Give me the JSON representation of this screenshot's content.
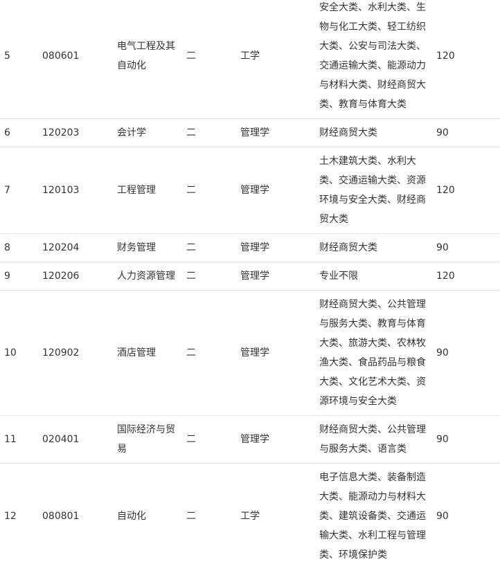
{
  "table": {
    "rows": [
      {
        "no": "5",
        "code": "080601",
        "major": "电气工程及其自动化",
        "degree_type": "二",
        "category": "工学",
        "groups": "安全大类、水利大类、生物与化工大类、轻工纺织大类、公安与司法大类、交通运输大类、能源动力与材料大类、财经商贸大类、教育与体育大类",
        "quota": "120"
      },
      {
        "no": "6",
        "code": "120203",
        "major": "会计学",
        "degree_type": "二",
        "category": "管理学",
        "groups": "财经商贸大类",
        "quota": "90"
      },
      {
        "no": "7",
        "code": "120103",
        "major": "工程管理",
        "degree_type": "二",
        "category": "管理学",
        "groups": "土木建筑大类、水利大类、交通运输大类、资源环境与安全大类、财经商贸大类",
        "quota": "120"
      },
      {
        "no": "8",
        "code": "120204",
        "major": "财务管理",
        "degree_type": "二",
        "category": "管理学",
        "groups": "财经商贸大类",
        "quota": "90"
      },
      {
        "no": "9",
        "code": "120206",
        "major": "人力资源管理",
        "degree_type": "二",
        "category": "管理学",
        "groups": "专业不限",
        "quota": "120"
      },
      {
        "no": "10",
        "code": "120902",
        "major": "酒店管理",
        "degree_type": "二",
        "category": "管理学",
        "groups": "财经商贸大类、公共管理与服务大类、教育与体育大类、旅游大类、农林牧渔大类、食品药品与粮食大类、文化艺术大类、资源环境与安全大类",
        "quota": "90"
      },
      {
        "no": "11",
        "code": "020401",
        "major": "国际经济与贸易",
        "degree_type": "二",
        "category": "管理学",
        "groups": "财经商贸大类、公共管理与服务大类、语言类",
        "quota": "90"
      },
      {
        "no": "12",
        "code": "080801",
        "major": "自动化",
        "degree_type": "二",
        "category": "工学",
        "groups": "电子信息大类、装备制造大类、能源动力与材料大类、建筑设备类、交通运输大类、水利工程与管理类、环境保护类",
        "quota": "90"
      }
    ]
  }
}
